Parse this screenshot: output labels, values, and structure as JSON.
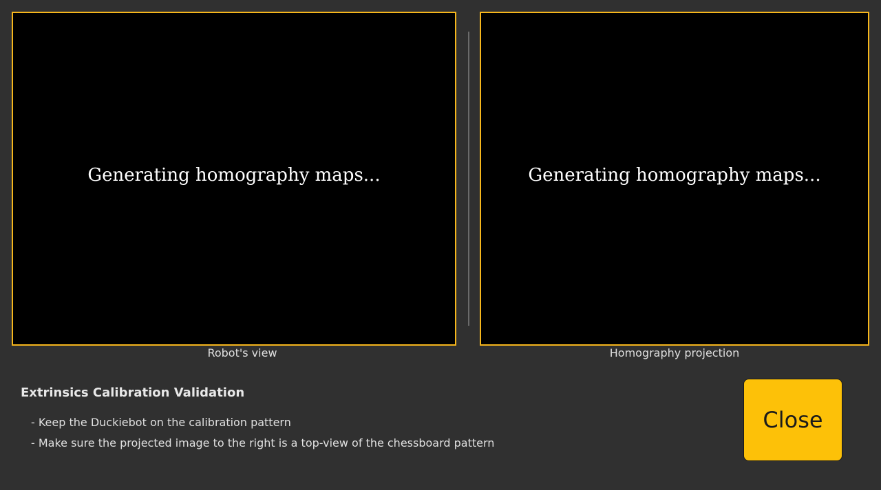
{
  "left_panel": {
    "message": "Generating homography maps...",
    "caption": "Robot's view"
  },
  "right_panel": {
    "message": "Generating homography maps...",
    "caption": "Homography projection"
  },
  "info": {
    "title": "Extrinsics Calibration Validation",
    "instructions": [
      "- Keep the Duckiebot on the calibration pattern",
      "- Make sure the projected image to the right is a top-view of the chessboard pattern"
    ]
  },
  "actions": {
    "close_label": "Close"
  },
  "colors": {
    "background": "#303030",
    "accent": "#f6b61c",
    "button": "#fdc108"
  }
}
